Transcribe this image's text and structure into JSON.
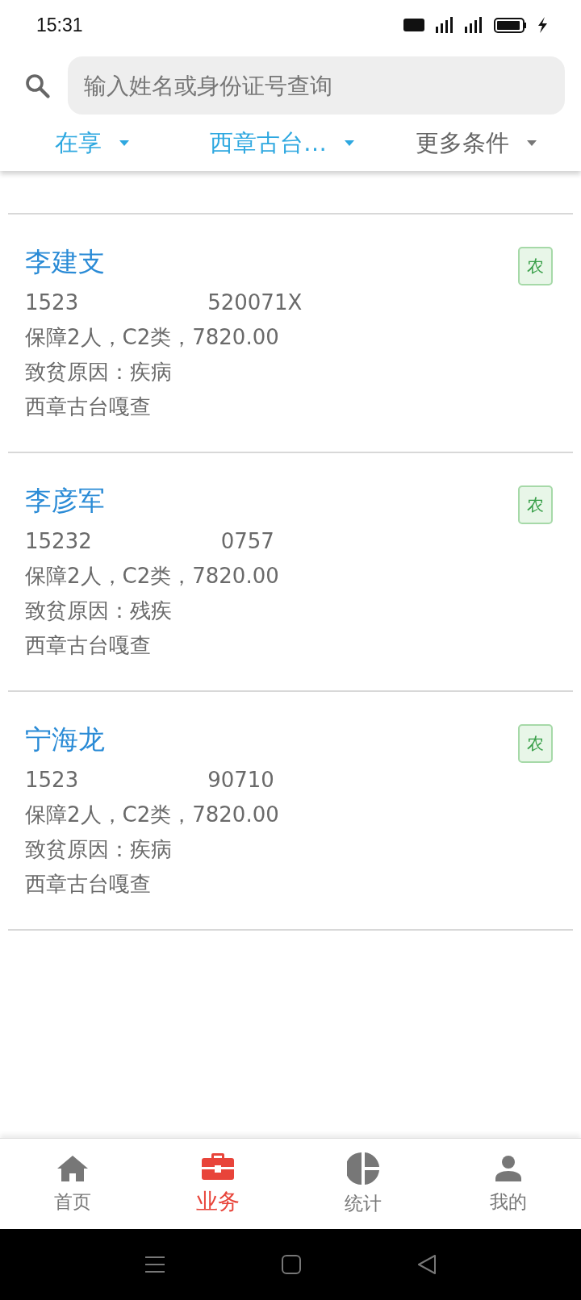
{
  "status_bar": {
    "time": "15:31"
  },
  "search": {
    "placeholder": "输入姓名或身份证号查询"
  },
  "filters": [
    {
      "label": "在享",
      "active": true
    },
    {
      "label": "西章古台…",
      "active": true
    },
    {
      "label": "更多条件",
      "active": false
    }
  ],
  "cards": [
    {
      "name": "李建支",
      "tag": "农",
      "id_parts": [
        "1523",
        "520071X"
      ],
      "support": "保障2人，C2类，7820.00",
      "cause": "致贫原因：疾病",
      "location": "西章古台嘎查"
    },
    {
      "name": "李彦军",
      "tag": "农",
      "id_parts": [
        "15232",
        "0757"
      ],
      "support": "保障2人，C2类，7820.00",
      "cause": "致贫原因：残疾",
      "location": "西章古台嘎查"
    },
    {
      "name": "宁海龙",
      "tag": "农",
      "id_parts": [
        "1523",
        "90710"
      ],
      "support": "保障2人，C2类，7820.00",
      "cause": "致贫原因：疾病",
      "location": "西章古台嘎查"
    }
  ],
  "tabs": [
    {
      "label": "首页",
      "selected": false
    },
    {
      "label": "业务",
      "selected": true
    },
    {
      "label": "统计",
      "selected": false
    },
    {
      "label": "我的",
      "selected": false
    }
  ]
}
